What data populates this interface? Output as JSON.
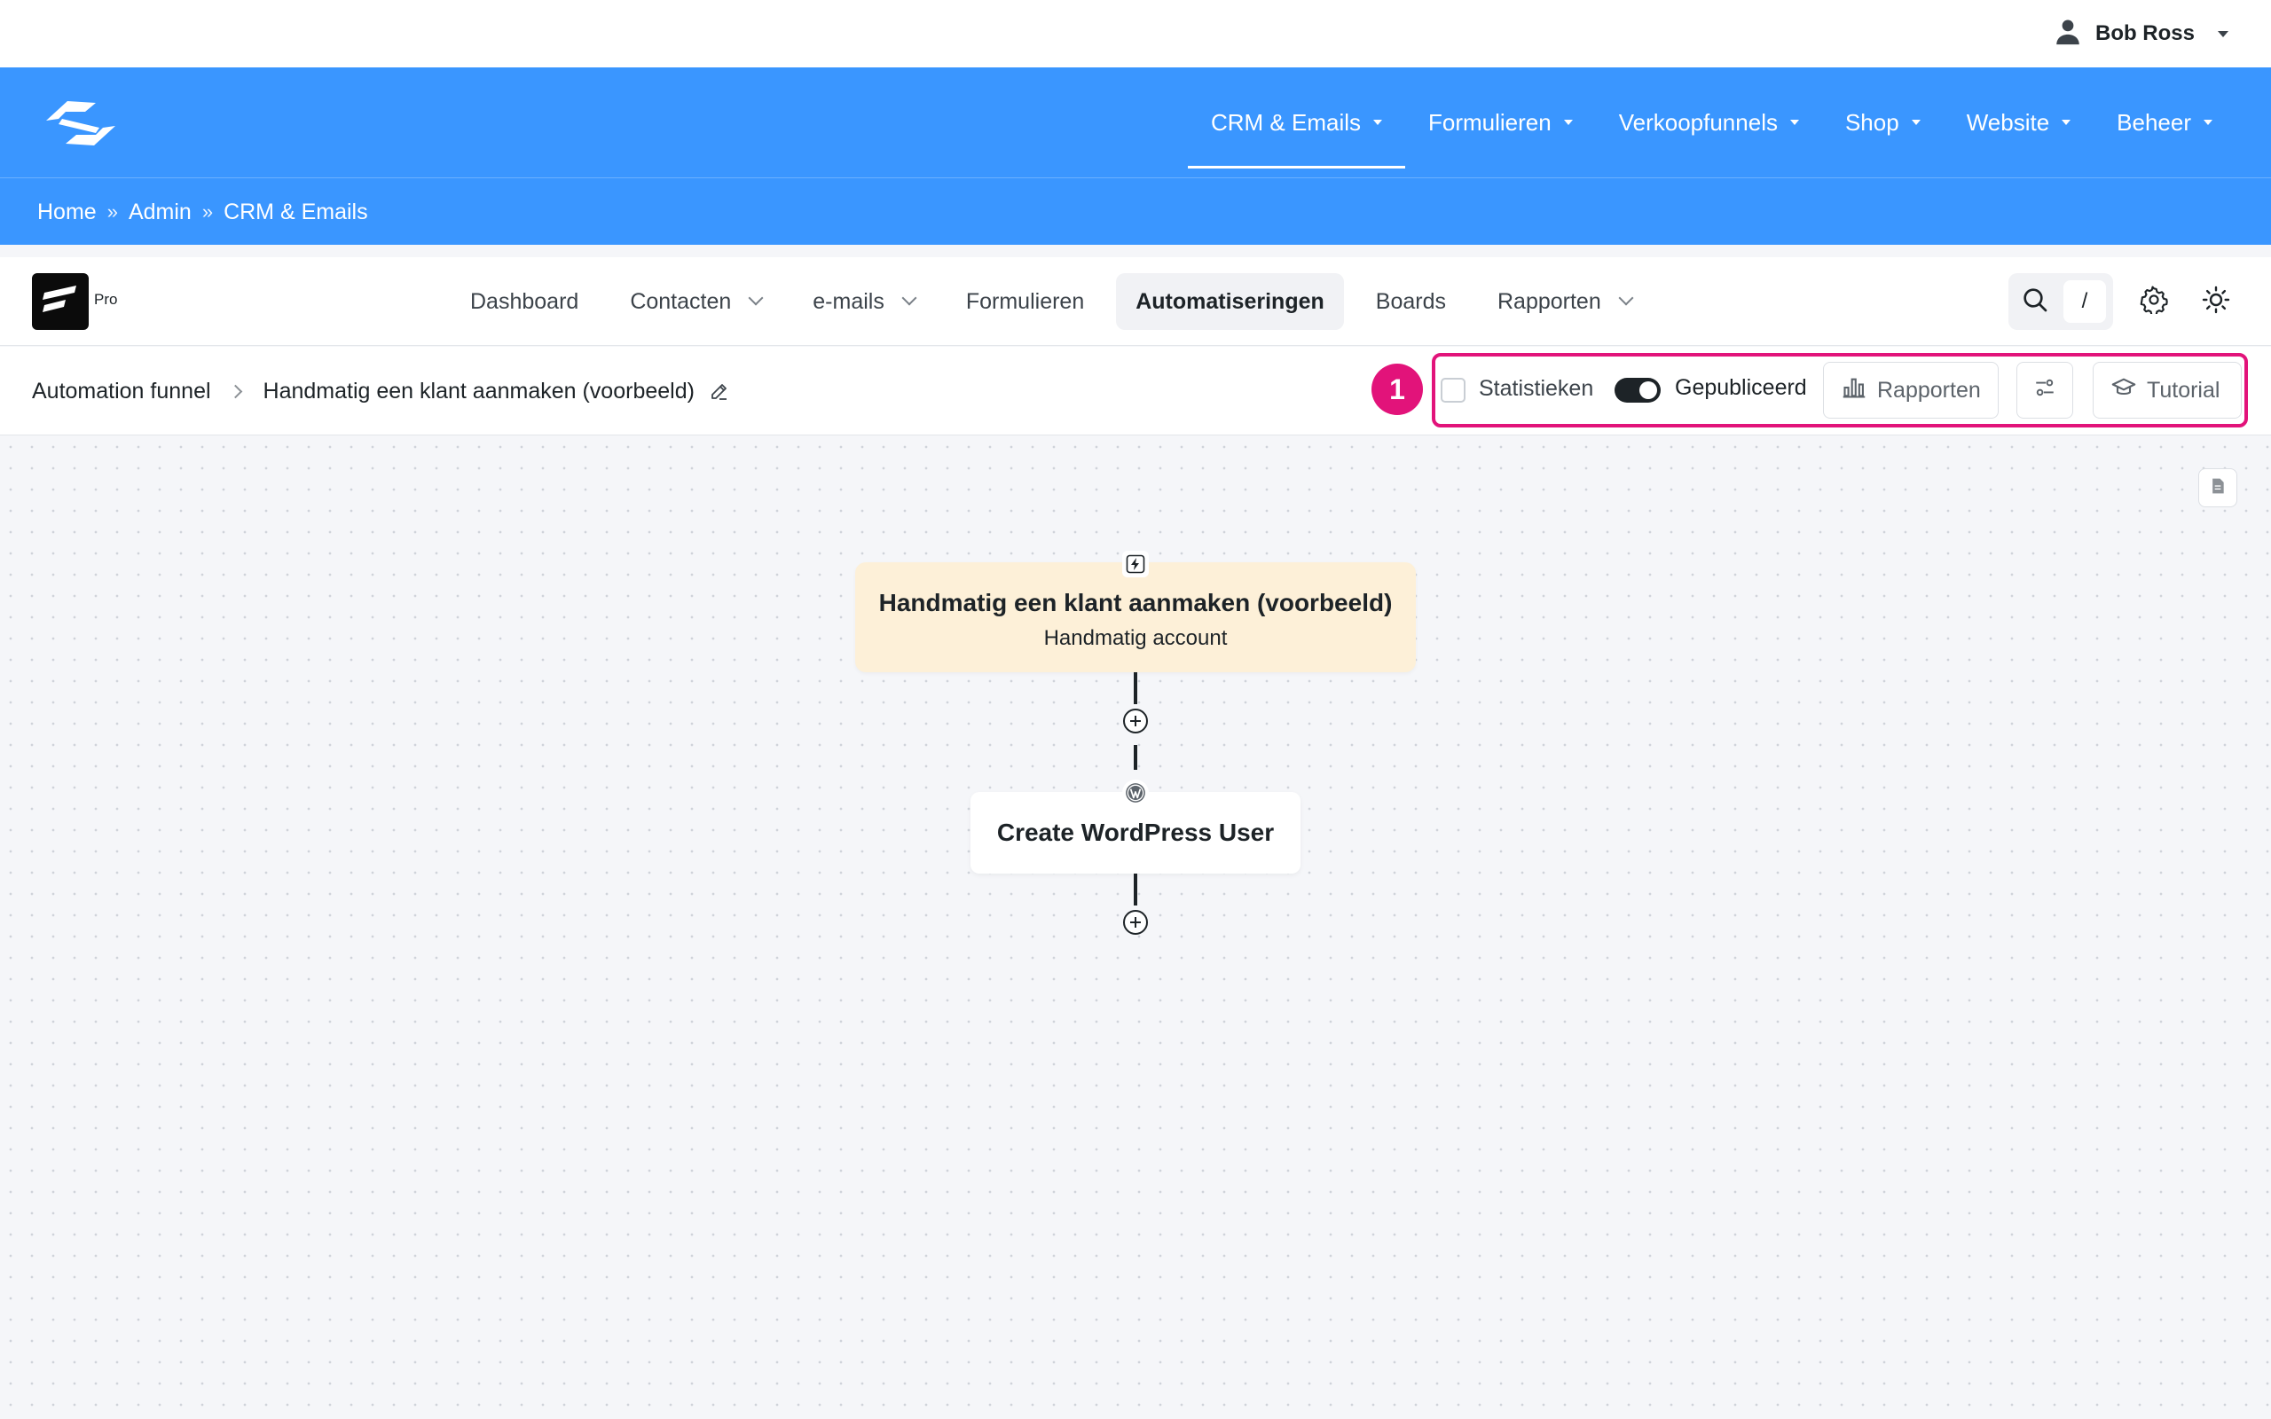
{
  "user": {
    "name": "Bob Ross"
  },
  "main_menu": [
    {
      "label": "CRM & Emails",
      "active": true
    },
    {
      "label": "Formulieren"
    },
    {
      "label": "Verkoopfunnels"
    },
    {
      "label": "Shop"
    },
    {
      "label": "Website"
    },
    {
      "label": "Beheer"
    }
  ],
  "breadcrumb": {
    "items": [
      "Home",
      "Admin",
      "CRM & Emails"
    ],
    "separator": "»"
  },
  "plugin": {
    "badge": "Pro",
    "nav": [
      "Dashboard",
      "Contacten",
      "e-mails",
      "Formulieren",
      "Automatiseringen",
      "Boards",
      "Rapporten"
    ],
    "active_nav": "Automatiseringen",
    "search_shortcut": "/"
  },
  "subheader": {
    "parent": "Automation funnel",
    "title": "Handmatig een klant aanmaken (voorbeeld)",
    "step_badge": "1",
    "stats_label": "Statistieken",
    "stats_checked": false,
    "published_label": "Gepubliceerd",
    "published": true,
    "reports_button": "Rapporten",
    "tutorial_button": "Tutorial"
  },
  "canvas": {
    "trigger": {
      "title": "Handmatig een klant aanmaken (voorbeeld)",
      "subtitle": "Handmatig account"
    },
    "action": {
      "title": "Create WordPress User"
    }
  },
  "colors": {
    "brand_blue": "#3a96ff",
    "highlight": "#e2137a",
    "trigger_bg": "#fdf0d8"
  }
}
